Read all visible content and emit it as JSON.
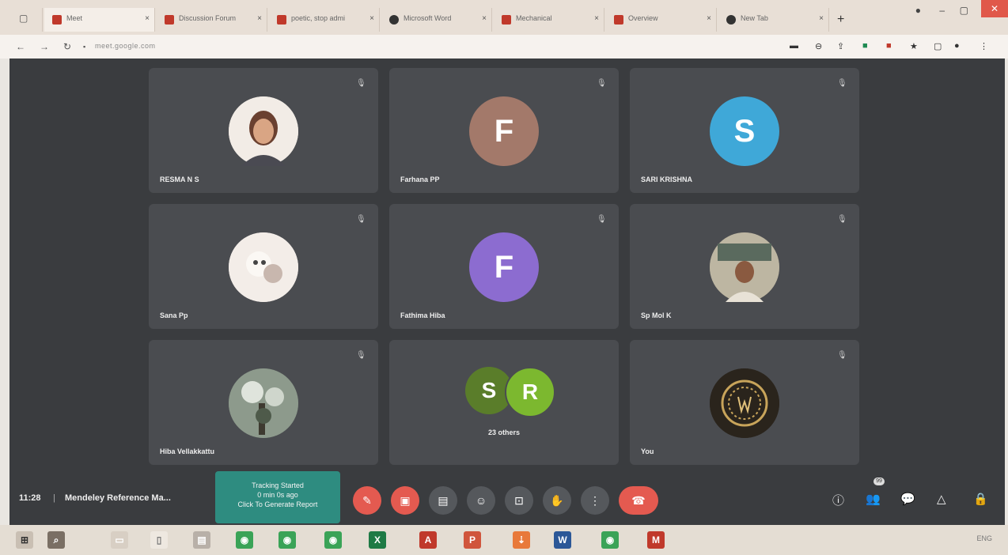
{
  "browser": {
    "tabs": [
      {
        "label": "Meet",
        "color": "#c0392b"
      },
      {
        "label": "Discussion Forum",
        "color": "#c0392b"
      },
      {
        "label": "poetic, stop admi",
        "color": "#c0392b"
      },
      {
        "label": "Microsoft Word",
        "color": "#333333"
      },
      {
        "label": "Mechanical",
        "color": "#c0392b"
      },
      {
        "label": "Overview",
        "color": "#c0392b"
      },
      {
        "label": "New Tab",
        "color": "#333333"
      }
    ],
    "new_tab_label": "+",
    "url": "meet.google.com"
  },
  "tiles": [
    {
      "name": "RESMA N S",
      "initial": "",
      "color": "#e8d8cc",
      "type": "photo"
    },
    {
      "name": "Farhana PP",
      "initial": "F",
      "color": "#a3796a",
      "type": "letter"
    },
    {
      "name": "SARI KRISHNA",
      "initial": "S",
      "color": "#3fa8d8",
      "type": "letter"
    },
    {
      "name": "Sana Pp",
      "initial": "",
      "color": "#efe7e2",
      "type": "photo"
    },
    {
      "name": "Fathima Hiba",
      "initial": "F",
      "color": "#8c6cd0",
      "type": "letter"
    },
    {
      "name": "Sp Mol K",
      "initial": "",
      "color": "#8a8370",
      "type": "photo"
    },
    {
      "name": "Hiba Vellakkattu",
      "initial": "",
      "color": "#6c7a6c",
      "type": "photo"
    },
    {
      "name": "",
      "initial": "",
      "color": "",
      "type": "others"
    },
    {
      "name": "You",
      "initial": "",
      "color": "#2e2820",
      "type": "photo"
    }
  ],
  "others": {
    "avatars": [
      {
        "initial": "S",
        "color": "#5a7d2a"
      },
      {
        "initial": "R",
        "color": "#7cb82f"
      }
    ],
    "label": "23 others"
  },
  "controls": {
    "time": "11:28",
    "separator": "|",
    "meeting_title": "Mendeley Reference Ma...",
    "tracker_lines": [
      "Tracking Started",
      "0 min 0s ago",
      "Click To Generate Report"
    ],
    "buttons": [
      "mic-off",
      "camera-off",
      "captions",
      "emoji",
      "present",
      "raise-hand",
      "more",
      "end-call"
    ],
    "right_badge": "99"
  },
  "taskbar": {
    "tray_text": "ENG"
  }
}
